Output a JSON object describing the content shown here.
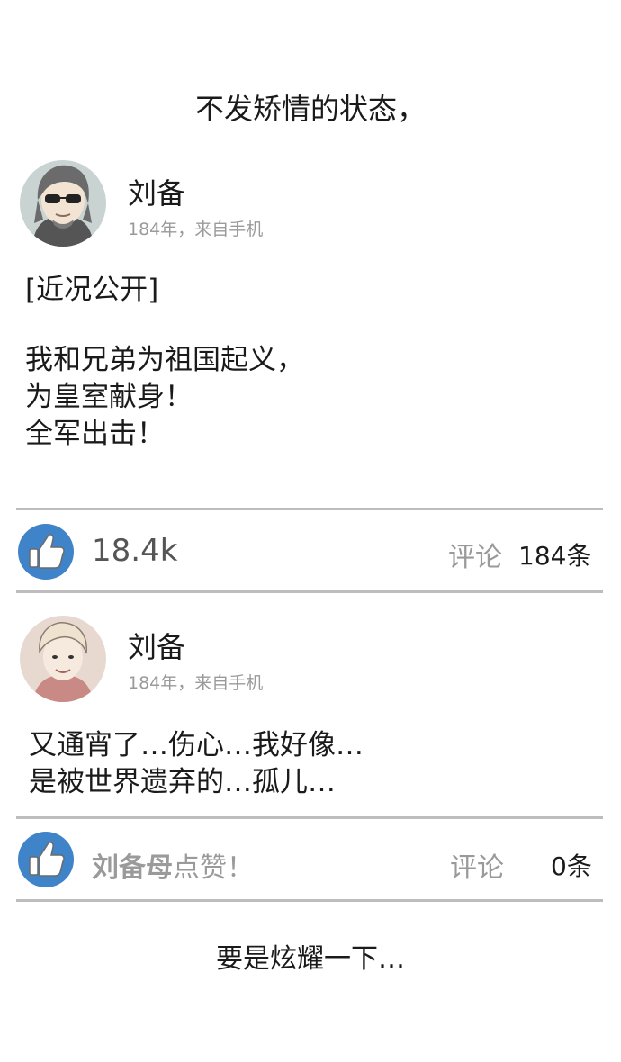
{
  "top_caption": "不发矫情的状态，",
  "posts": [
    {
      "author": "刘备",
      "meta": "184年，来自手机",
      "tag": "[近况公开]",
      "body": "我和兄弟为祖国起义，\n为皇室献身！\n全军出击！",
      "likes": "18.4k",
      "comment_label": "评论",
      "comment_count": "184条"
    },
    {
      "author": "刘备",
      "meta": "184年，来自手机",
      "body": "又通宵了…伤心…我好像…\n是被世界遗弃的…孤儿…",
      "liker_name": "刘备母",
      "liker_action": "点赞！",
      "comment_label": "评论",
      "comment_count": "0条"
    }
  ],
  "bottom_caption": "要是炫耀一下…",
  "colors": {
    "like_button": "#3f83c9",
    "divider": "#bdbdbd",
    "meta_text": "#9a9a9a"
  },
  "icons": {
    "like": "thumbs-up-icon"
  }
}
